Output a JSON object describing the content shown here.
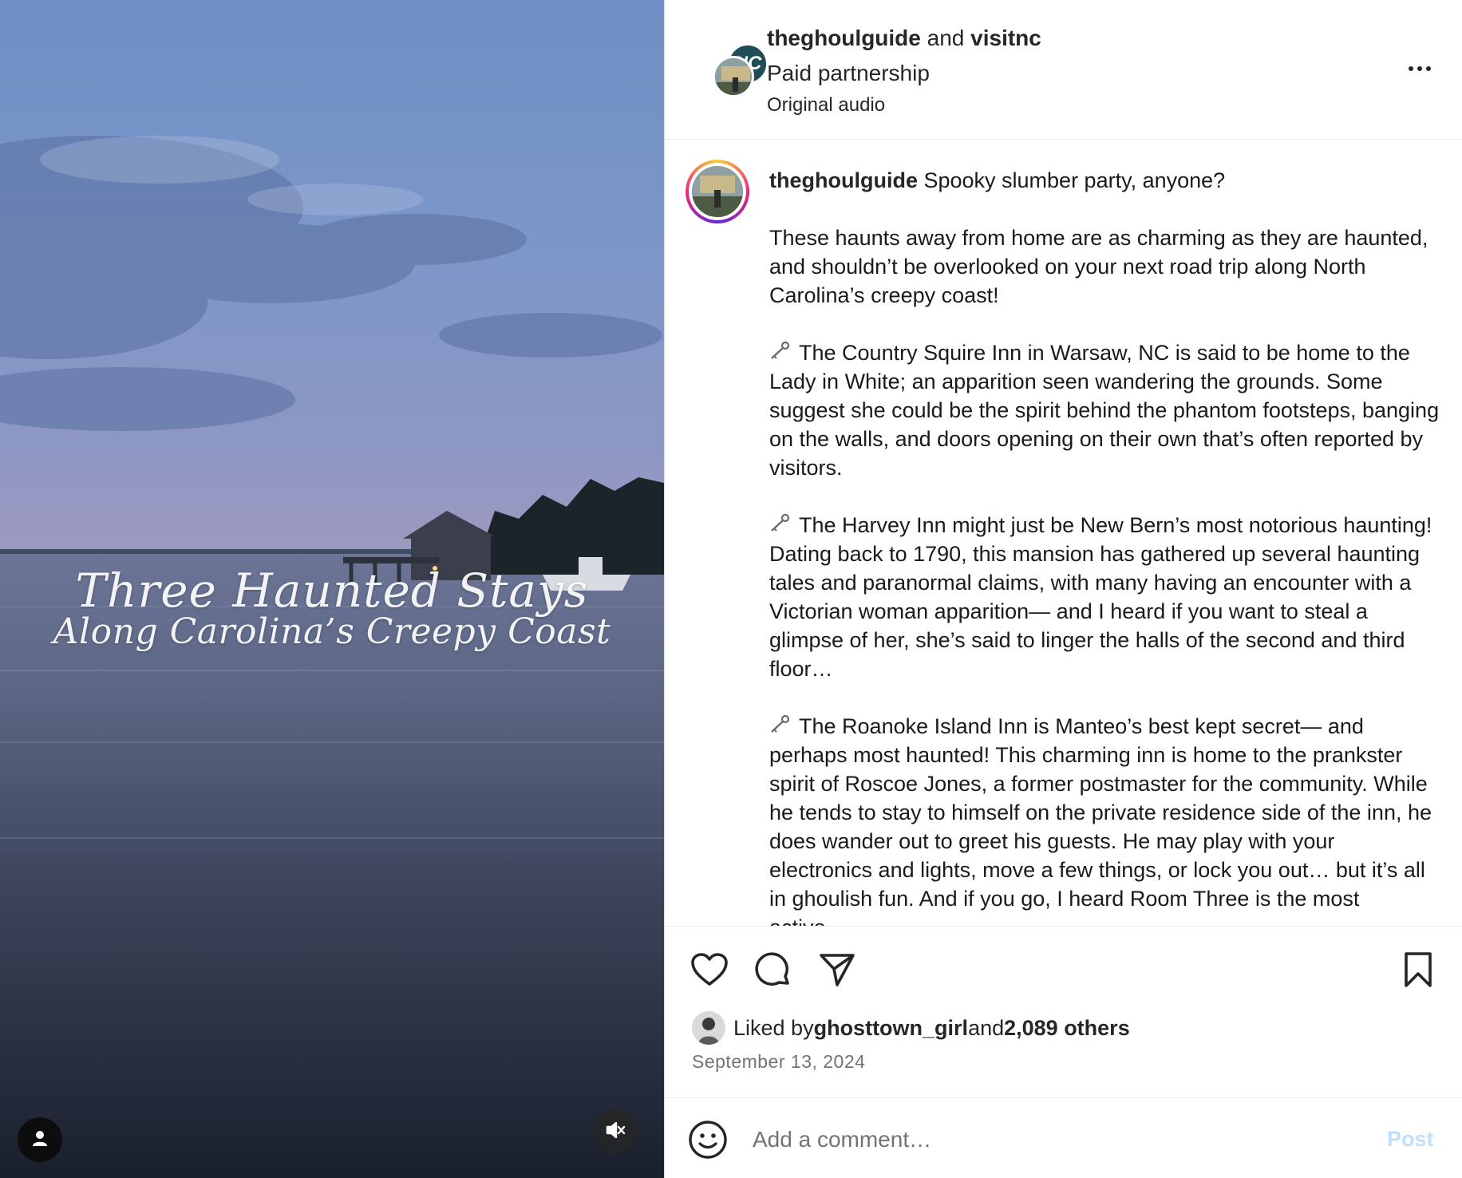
{
  "media": {
    "title_line1": "Three Haunted Stays",
    "title_line2": "Along Carolina’s Creepy Coast",
    "user_icon": "user-icon",
    "mute_icon": "speaker-muted-icon"
  },
  "header": {
    "author": "theghoulguide",
    "joiner": " and ",
    "coauthor": "visitnc",
    "partnership": "Paid partnership",
    "audio": "Original audio",
    "coauthor_badge": "NC",
    "more_icon": "more-options-icon"
  },
  "caption": {
    "username": "theghoulguide",
    "first_line": " Spooky slumber party, anyone?",
    "paragraphs": [
      "These haunts away from home are as charming as they are haunted, and shouldn’t be overlooked on your next road trip along North Carolina’s creepy coast!",
      " The Country Squire Inn in Warsaw, NC is said to be home to the Lady in White; an apparition seen wandering the grounds. Some suggest she could be the spirit behind the phantom footsteps, banging on the walls, and doors opening on their own that’s often reported by visitors.",
      " The Harvey Inn might just be New Bern’s most notorious haunting! Dating back to 1790, this mansion has gathered up several haunting tales and paranormal claims, with many having an encounter with a Victorian woman apparition— and I heard if you want to steal a glimpse of her, she’s said to linger the halls of the second and third floor…",
      " The Roanoke Island Inn is Manteo’s best kept secret— and perhaps most haunted! This charming inn is home to the prankster spirit of Roscoe Jones, a former postmaster for the community. While he tends to stay to himself on the private residence side of the inn, he does wander out to greet his guests. He may play with your electronics and lights, move a few things, or lock you out… but it’s all in ghoulish fun. And if you go, I heard Room Three is the most active…"
    ],
    "bullet_icon": "old-key-icon"
  },
  "actions": {
    "like_icon": "heart-icon",
    "comment_icon": "comment-icon",
    "share_icon": "send-icon",
    "save_icon": "bookmark-icon",
    "liked_by_prefix": "Liked by ",
    "liked_by_user": "ghosttown_girl",
    "liked_by_and": " and ",
    "liked_by_others": "2,089 others",
    "date": "September 13, 2024"
  },
  "comment": {
    "emoji_icon": "emoji-smile-icon",
    "placeholder": "Add a comment…",
    "post_label": "Post"
  },
  "colors": {
    "post_disabled": "#c0dffd",
    "nc_badge": "#1f4e57",
    "text": "#262626",
    "muted": "#737373"
  }
}
